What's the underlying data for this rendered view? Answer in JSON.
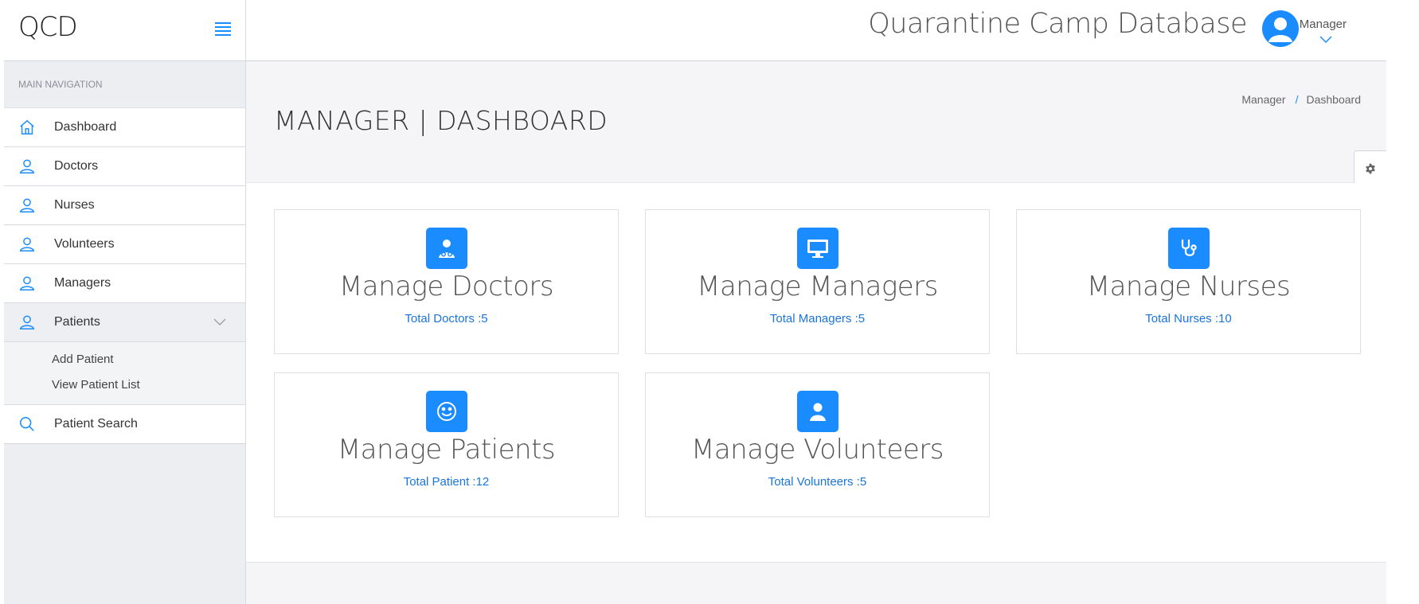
{
  "app": {
    "brand": "QCD",
    "title": "Quarantine Camp Database"
  },
  "user": {
    "name": "Manager"
  },
  "sidebar": {
    "header": "MAIN NAVIGATION",
    "items": [
      {
        "label": "Dashboard",
        "icon": "home-icon"
      },
      {
        "label": "Doctors",
        "icon": "user-icon"
      },
      {
        "label": "Nurses",
        "icon": "user-icon"
      },
      {
        "label": "Volunteers",
        "icon": "user-icon"
      },
      {
        "label": "Managers",
        "icon": "user-icon"
      },
      {
        "label": "Patients",
        "icon": "user-icon",
        "expanded": true
      }
    ],
    "patients_submenu": [
      {
        "label": "Add Patient"
      },
      {
        "label": "View Patient List"
      }
    ],
    "search_item": {
      "label": "Patient Search",
      "icon": "search-icon"
    }
  },
  "page": {
    "title": "MANAGER | DASHBOARD",
    "breadcrumb": [
      "Manager",
      "Dashboard"
    ]
  },
  "cards": [
    {
      "title": "Manage Doctors",
      "total": "Total Doctors :5",
      "icon": "doctor-icon"
    },
    {
      "title": "Manage Managers",
      "total": "Total Managers :5",
      "icon": "monitor-icon"
    },
    {
      "title": "Manage Nurses",
      "total": "Total Nurses :10",
      "icon": "stethoscope-icon"
    },
    {
      "title": "Manage Patients",
      "total": "Total Patient :12",
      "icon": "smiley-icon"
    },
    {
      "title": "Manage Volunteers",
      "total": "Total Volunteers :5",
      "icon": "person-icon"
    }
  ],
  "colors": {
    "accent": "#1a8cff",
    "link": "#1a74d9",
    "sidebar_bg": "#edeef2",
    "header_bg": "#f5f5f7"
  }
}
